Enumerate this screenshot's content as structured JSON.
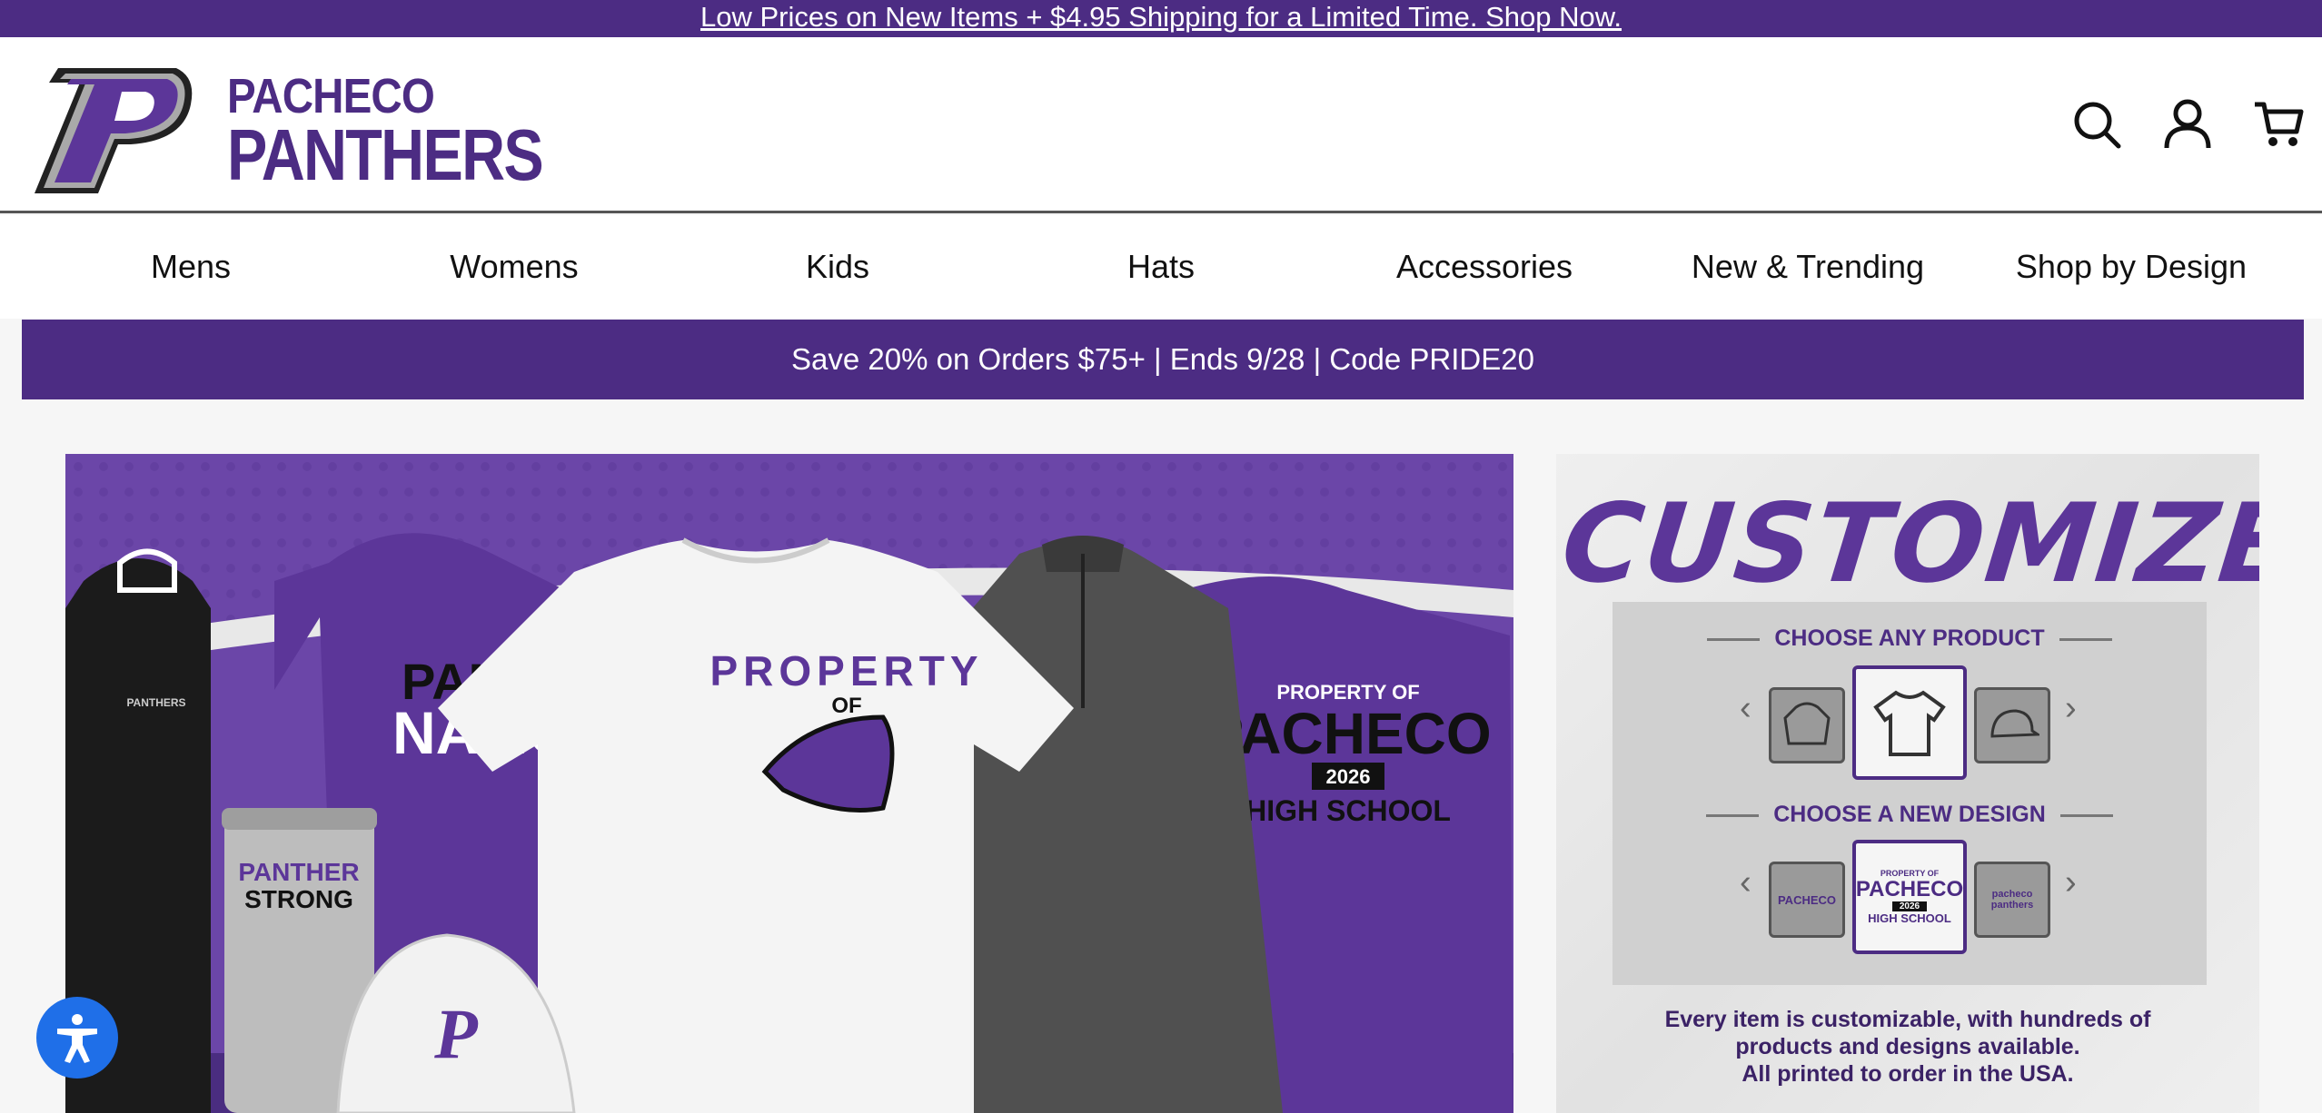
{
  "topbar": {
    "text": "Low Prices on New Items + $4.95 Shipping for a Limited Time. Shop Now."
  },
  "header": {
    "logo_line1": "PACHECO",
    "logo_line2": "PANTHERS",
    "icons": [
      "search-icon",
      "account-icon",
      "cart-icon"
    ]
  },
  "nav": {
    "items": [
      "Mens",
      "Womens",
      "Kids",
      "Hats",
      "Accessories",
      "New & Trending",
      "Shop by Design"
    ]
  },
  "promo": {
    "text": "Save 20% on Orders $75+ | Ends 9/28 | Code PRIDE20"
  },
  "hero": {
    "backpack_text": "PANTHERS",
    "hoodie_text_1": "PANTHE",
    "hoodie_text_2": "NATIO",
    "tee_text_1": "PROPERTY",
    "tee_text_2": "OF",
    "tumbler_text_1": "PANTHER",
    "tumbler_text_2": "STRONG",
    "longsleeve_text_1": "PROPERTY OF",
    "longsleeve_text_2": "PACHECO",
    "longsleeve_year": "2026",
    "longsleeve_text_3": "HIGH SCHOOL",
    "hat_text": "P"
  },
  "customize": {
    "title": "CUSTOMIZE IT",
    "choose_product": "CHOOSE ANY PRODUCT",
    "choose_design": "CHOOSE A NEW DESIGN",
    "design_center_1": "PROPERTY OF",
    "design_center_2": "PACHECO",
    "design_center_year": "2026",
    "design_center_3": "HIGH SCHOOL",
    "design_left": "PACHECO",
    "design_right": "pacheco panthers",
    "line1": "Every item is customizable, with hundreds of",
    "line2": "products and designs available.",
    "line3": "All printed to order in the USA."
  },
  "colors": {
    "brand_purple": "#4c2c83",
    "a11y_blue": "#1f6fe8"
  }
}
